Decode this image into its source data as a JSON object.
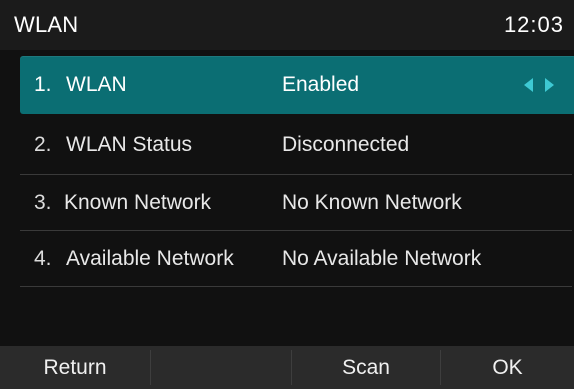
{
  "title_bar": {
    "title": "WLAN",
    "clock": "12:03"
  },
  "menu": {
    "items": [
      {
        "number": "1.",
        "label": "WLAN",
        "value": "Enabled",
        "selected": true
      },
      {
        "number": "2.",
        "label": "WLAN Status",
        "value": "Disconnected",
        "selected": false
      },
      {
        "number": "3.",
        "label": "Known Network",
        "value": "No Known Network",
        "selected": false
      },
      {
        "number": "4.",
        "label": "Available Network",
        "value": "No Available Network",
        "selected": false
      }
    ]
  },
  "softkeys": {
    "return_label": "Return",
    "scan_label": "Scan",
    "ok_label": "OK"
  },
  "colors": {
    "selection_bg": "#0b6e73",
    "arrow": "#3ec9d3",
    "background": "#111111",
    "softkey_bar": "#2b2b2b"
  },
  "icons": {
    "selector_arrows": "left-right-arrows-icon"
  }
}
